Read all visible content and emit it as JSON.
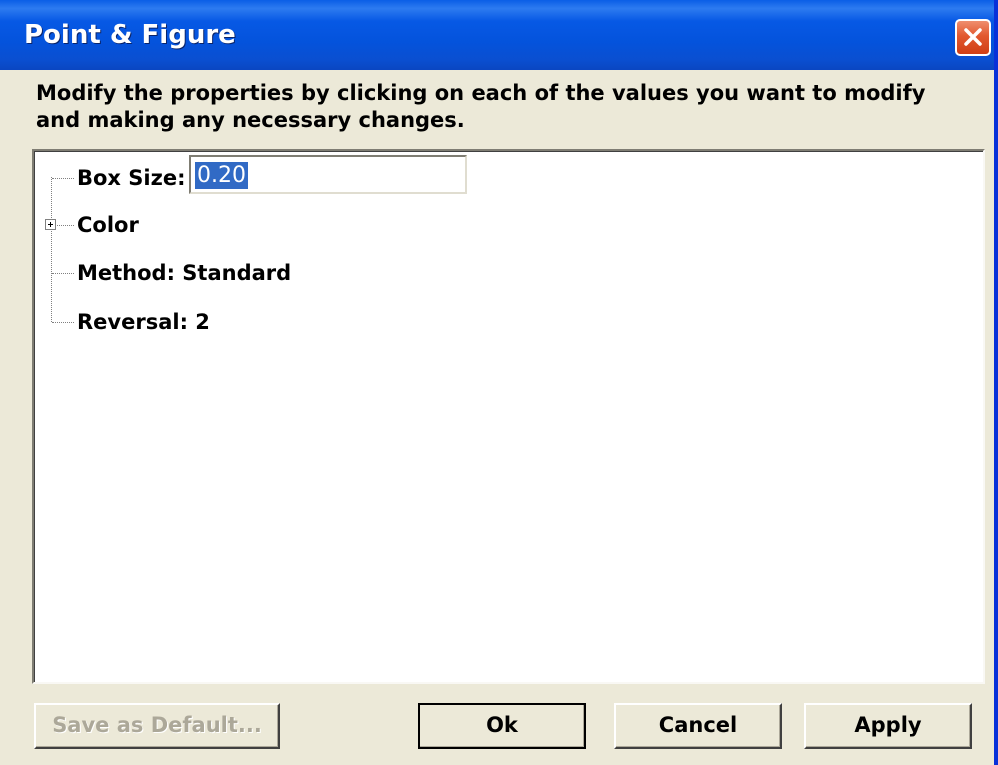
{
  "window": {
    "title": "Point & Figure"
  },
  "instructions": "Modify the properties by clicking on each of the values you want to modify and making any necessary changes.",
  "properties": {
    "box_size": {
      "label": "Box Size:",
      "value": "0.20"
    },
    "color": {
      "label": "Color",
      "expanded": false
    },
    "method": {
      "label": "Method: Standard"
    },
    "reversal": {
      "label": "Reversal: 2"
    }
  },
  "buttons": {
    "save_default": {
      "label": "Save as Default...",
      "enabled": false
    },
    "ok": {
      "label": "Ok"
    },
    "cancel": {
      "label": "Cancel"
    },
    "apply": {
      "label": "Apply"
    }
  },
  "icons": {
    "close": "close-icon",
    "expand": "plus-expander-icon"
  },
  "colors": {
    "title_bar": "#0453dc",
    "close_button": "#e2582f",
    "selection": "#316ac5",
    "dialog_bg": "#ece9d8"
  }
}
